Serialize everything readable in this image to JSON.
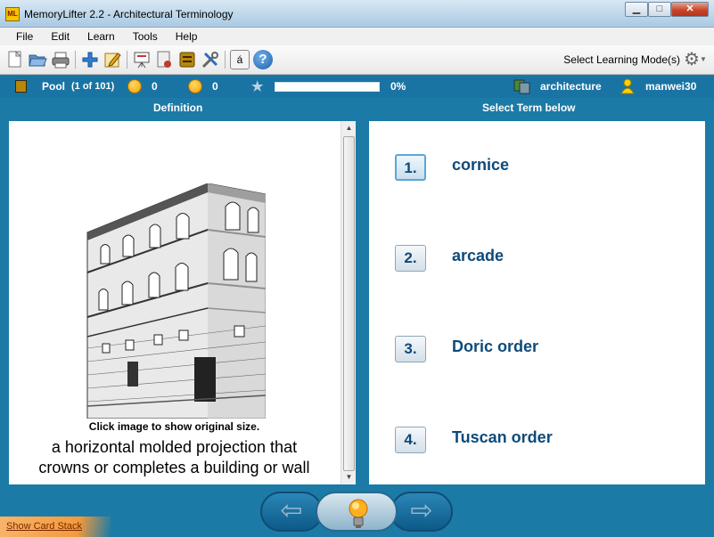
{
  "window": {
    "title": "MemoryLifter 2.2 - Architectural Terminology",
    "app_icon_text": "ML",
    "minimize": "▁",
    "maximize": "□",
    "close": "✕"
  },
  "menu": [
    "File",
    "Edit",
    "Learn",
    "Tools",
    "Help"
  ],
  "toolbar": {
    "icons": [
      "new-icon",
      "open-icon",
      "print-icon",
      "add-card-icon",
      "edit-icon",
      "presentation-icon",
      "statistics-icon",
      "box-icon",
      "tools-icon",
      "special-char-icon",
      "help-icon"
    ],
    "select_mode_label": "Select Learning Mode(s)",
    "special_char": "á",
    "help_char": "?"
  },
  "status": {
    "pool_label": "Pool",
    "pool_count": "(1 of 101)",
    "correct_count": "0",
    "wrong_count": "0",
    "progress_value": 0,
    "progress_text": "0%",
    "dictionary": "architecture",
    "user": "manwei30"
  },
  "headers": {
    "left": "Definition",
    "right": "Select Term below"
  },
  "card": {
    "click_hint": "Click image to show original size.",
    "definition_line1": "a horizontal molded projection that",
    "definition_line2": "crowns or completes a building or wall"
  },
  "answers": [
    {
      "number": "1.",
      "term": "cornice"
    },
    {
      "number": "2.",
      "term": "arcade"
    },
    {
      "number": "3.",
      "term": "Doric order"
    },
    {
      "number": "4.",
      "term": "Tuscan order"
    }
  ],
  "nav": {
    "back": "⇦",
    "next": "⇨"
  },
  "bottom_link": "Show Card Stack",
  "colors": {
    "background": "#1c7aa6",
    "term_text": "#0d4a7a",
    "card_stack_tab": "#f39a3b"
  }
}
